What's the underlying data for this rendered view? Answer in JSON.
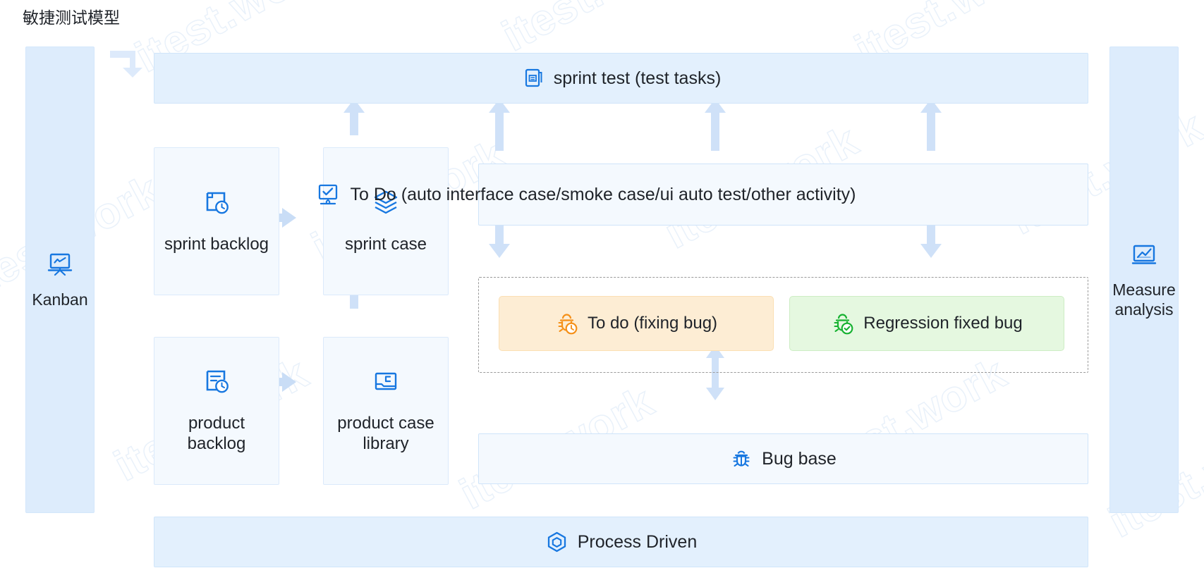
{
  "page": {
    "title": "敏捷测试模型",
    "watermark_text": "itest.work",
    "background": "#ffffff"
  },
  "colors": {
    "band_fill": "#e3f0fd",
    "band_border": "#d0e5fa",
    "card_fill": "#f4f9fe",
    "card_border": "#dbeafb",
    "side_fill": "#ddecfc",
    "accent_blue": "#1a73e8",
    "icon_blue": "#1777e0",
    "orange_fill": "#fdedd4",
    "orange_icon": "#f59018",
    "green_fill": "#e5f8e0",
    "green_icon": "#17b231",
    "arrow_blue": "#c3dcf7",
    "dashed_border": "#9a9a9a",
    "text": "#1f2329"
  },
  "sidebars": {
    "left": {
      "label": "Kanban",
      "icon": "kanban-board-icon"
    },
    "right": {
      "label": "Measure\nanalysis",
      "icon": "line-chart-icon"
    }
  },
  "bands": {
    "sprint_test": {
      "label": "sprint test (test tasks)",
      "icon": "test-task-doc-icon"
    },
    "todo_activities": {
      "label": "To Do (auto interface case/smoke case/ui auto test/other activity)",
      "icon": "monitor-check-icon"
    },
    "bug_base": {
      "label": "Bug base",
      "icon": "bug-icon"
    },
    "process_driven": {
      "label": "Process Driven",
      "icon": "hexagon-process-icon"
    }
  },
  "cards": [
    {
      "key": "sprint_backlog",
      "label": "sprint backlog",
      "icon": "backlog-clock-icon"
    },
    {
      "key": "sprint_case",
      "label": "sprint case",
      "icon": "layers-icon"
    },
    {
      "key": "product_backlog",
      "label": "product\nbacklog",
      "icon": "document-clock-icon"
    },
    {
      "key": "product_case_library",
      "label": "product  case\nlibrary",
      "icon": "case-library-icon"
    }
  ],
  "bug_pills": [
    {
      "key": "todo_fixing_bug",
      "label": "To do (fixing bug)",
      "icon": "bug-clock-icon",
      "color": "orange"
    },
    {
      "key": "regression_fixed_bug",
      "label": "Regression fixed bug",
      "icon": "bug-check-icon",
      "color": "green"
    }
  ],
  "arrows": [
    {
      "name": "hook-arrow-to-sprint-test",
      "direction": "hook-right"
    },
    {
      "name": "sprint-backlog-to-sprint-case",
      "direction": "right"
    },
    {
      "name": "product-backlog-to-product-case-library",
      "direction": "right"
    },
    {
      "name": "product-case-library-to-sprint-case",
      "direction": "up"
    },
    {
      "name": "sprint-case-to-sprint-test",
      "direction": "up"
    },
    {
      "name": "todo-activities-to-sprint-test",
      "direction": "up"
    },
    {
      "name": "todo-activities-to-sprint-test-mid",
      "direction": "up"
    },
    {
      "name": "todo-activities-to-sprint-test-right",
      "direction": "up"
    },
    {
      "name": "todo-to-fixing-bug",
      "direction": "down"
    },
    {
      "name": "todo-to-regression-bug",
      "direction": "down"
    },
    {
      "name": "bug-base-bidirectional",
      "direction": "up-down"
    }
  ]
}
